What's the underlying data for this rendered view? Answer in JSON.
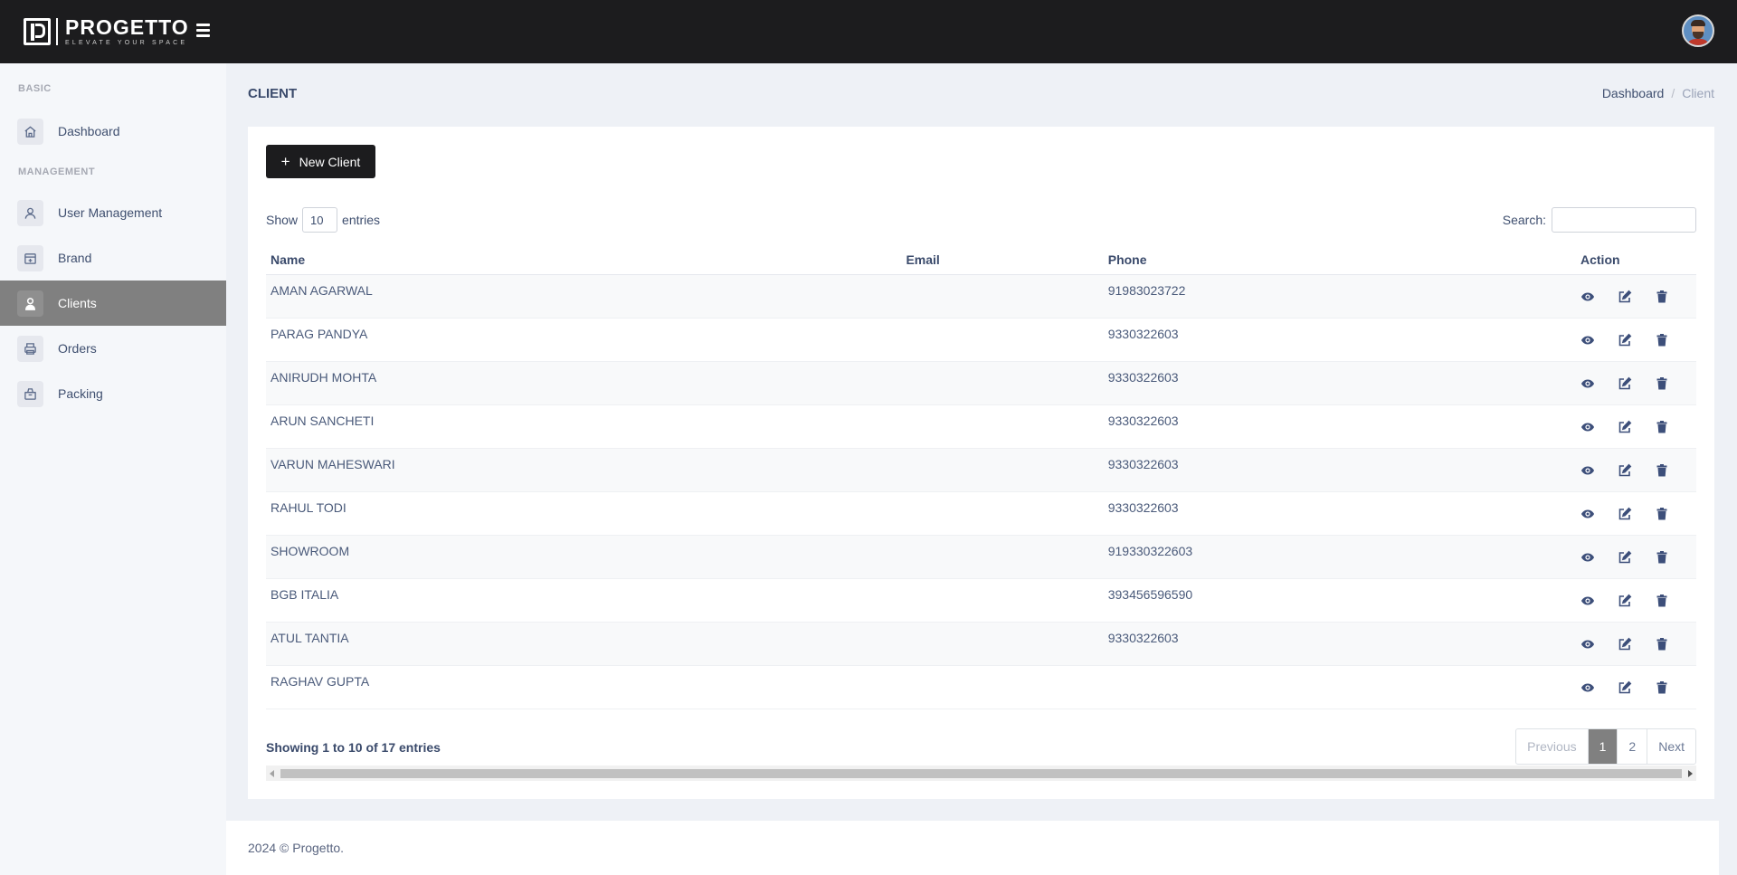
{
  "brand": {
    "name": "PROGETTO",
    "tagline": "ELEVATE YOUR SPACE"
  },
  "sidebar": {
    "sections": [
      {
        "label": "BASIC",
        "items": [
          {
            "label": "Dashboard",
            "icon": "home-icon"
          }
        ]
      },
      {
        "label": "MANAGEMENT",
        "items": [
          {
            "label": "User Management",
            "icon": "user-icon"
          },
          {
            "label": "Brand",
            "icon": "calendar-icon"
          },
          {
            "label": "Clients",
            "icon": "client-icon",
            "active": true
          },
          {
            "label": "Orders",
            "icon": "printer-icon"
          },
          {
            "label": "Packing",
            "icon": "box-icon"
          }
        ]
      }
    ]
  },
  "page": {
    "title": "CLIENT"
  },
  "breadcrumb": {
    "home": "Dashboard",
    "separator": "/",
    "current": "Client"
  },
  "toolbar": {
    "new_button": "New Client",
    "plus": "+"
  },
  "table_controls": {
    "show_label": "Show",
    "entries_label": "entries",
    "page_size": "10",
    "search_label": "Search:",
    "search_value": ""
  },
  "table": {
    "columns": [
      "Name",
      "Email",
      "Phone",
      "Action"
    ],
    "rows": [
      {
        "name": "AMAN AGARWAL",
        "email": "",
        "phone": "91983023722"
      },
      {
        "name": "PARAG PANDYA",
        "email": "",
        "phone": "9330322603"
      },
      {
        "name": "ANIRUDH MOHTA",
        "email": "",
        "phone": "9330322603"
      },
      {
        "name": "ARUN SANCHETI",
        "email": "",
        "phone": "9330322603"
      },
      {
        "name": "VARUN MAHESWARI",
        "email": "",
        "phone": "9330322603"
      },
      {
        "name": "RAHUL TODI",
        "email": "",
        "phone": "9330322603"
      },
      {
        "name": "SHOWROOM",
        "email": "",
        "phone": "919330322603"
      },
      {
        "name": "BGB ITALIA",
        "email": "",
        "phone": "393456596590"
      },
      {
        "name": "ATUL TANTIA",
        "email": "",
        "phone": "9330322603"
      },
      {
        "name": "RAGHAV GUPTA",
        "email": "",
        "phone": ""
      }
    ],
    "row_actions": [
      "eye-icon",
      "edit-icon",
      "trash-icon"
    ]
  },
  "pagination": {
    "info": "Showing 1 to 10 of 17 entries",
    "previous": "Previous",
    "pages": [
      "1",
      "2"
    ],
    "current": "1",
    "next": "Next"
  },
  "footer": {
    "text": "2024 © Progetto."
  },
  "colors": {
    "topbar": "#1c1c1e",
    "active_nav": "#808080",
    "icon": "#3d4f7a",
    "text": "#3a4a6b"
  }
}
